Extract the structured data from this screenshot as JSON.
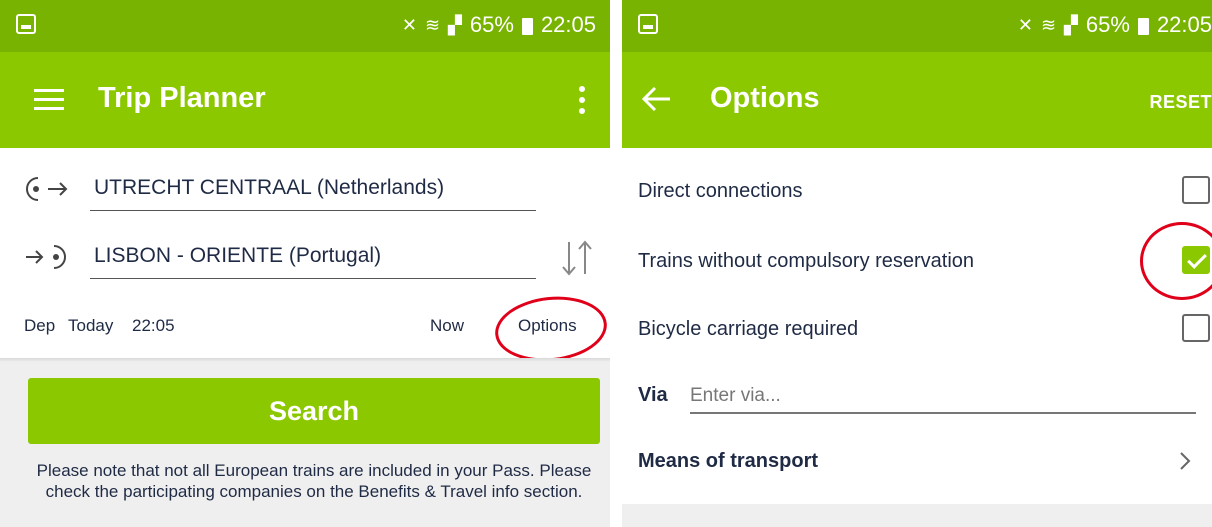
{
  "status_bar": {
    "battery": "65%",
    "time": "22:05"
  },
  "trip_planner": {
    "title": "Trip Planner",
    "from": "UTRECHT CENTRAAL (Netherlands)",
    "to": "LISBON - ORIENTE (Portugal)",
    "dep_label": "Dep",
    "dep_day": "Today",
    "dep_time": "22:05",
    "now_label": "Now",
    "options_label": "Options",
    "search_label": "Search",
    "note": "Please note that not all European trains are included in your Pass. Please check the participating companies on the Benefits & Travel info section."
  },
  "options": {
    "title": "Options",
    "reset_label": "RESET",
    "items": [
      {
        "label": "Direct connections",
        "checked": false
      },
      {
        "label": "Trains without compulsory reservation",
        "checked": true
      },
      {
        "label": "Bicycle carriage required",
        "checked": false
      }
    ],
    "via_label": "Via",
    "via_placeholder": "Enter via...",
    "via_value": "",
    "means_label": "Means of transport"
  },
  "colors": {
    "status_bar": "#77b300",
    "app_bar": "#8cc800",
    "highlight_circle": "#e0001a",
    "text_dark": "#1f2a44"
  }
}
